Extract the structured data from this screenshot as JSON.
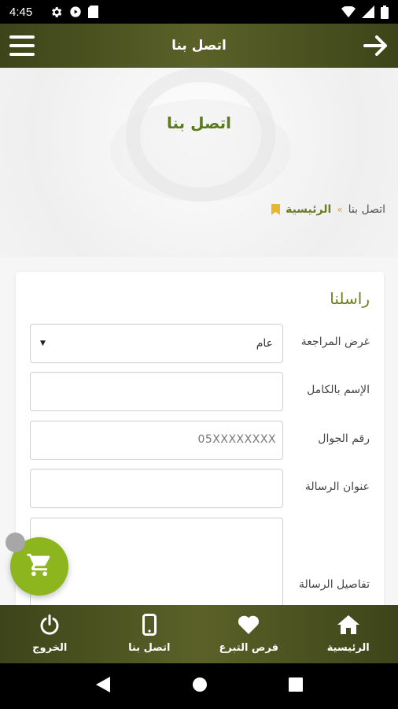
{
  "status_bar": {
    "time": "4:45",
    "icons": [
      "gear-icon",
      "play-protect-icon",
      "sd-card-icon",
      "wifi-icon",
      "signal-icon",
      "battery-icon"
    ]
  },
  "app_bar": {
    "title": "اتصل بنا",
    "menu_icon": "hamburger-menu-icon",
    "back_icon": "arrow-right-icon"
  },
  "hero": {
    "title": "اتصل بنا"
  },
  "breadcrumb": {
    "home": "الرئيسية",
    "separator": "»",
    "current": "اتصل بنا"
  },
  "form": {
    "title": "راسلنا",
    "fields": [
      {
        "label": "غرض المراجعة",
        "type": "select",
        "value": "عام"
      },
      {
        "label": "الإسم بالكامل",
        "type": "text",
        "value": ""
      },
      {
        "label": "رقم الجوال",
        "type": "tel",
        "placeholder": "05XXXXXXXX"
      },
      {
        "label": "عنوان الرسالة",
        "type": "text",
        "value": ""
      },
      {
        "label": "تفاصيل الرسالة",
        "type": "textarea",
        "value": ""
      }
    ]
  },
  "fab": {
    "icon": "shopping-cart-icon"
  },
  "bottom_nav": {
    "items": [
      {
        "label": "الرئيسية",
        "icon": "home-icon"
      },
      {
        "label": "فرص التبرع",
        "icon": "heart-icon"
      },
      {
        "label": "اتصل بنا",
        "icon": "smartphone-icon"
      },
      {
        "label": "الخروج",
        "icon": "power-icon"
      }
    ]
  },
  "colors": {
    "primary_dark": "#3d4419",
    "primary_mid": "#5a6128",
    "accent_green": "#8db51d",
    "title_green": "#5a7a1d"
  }
}
